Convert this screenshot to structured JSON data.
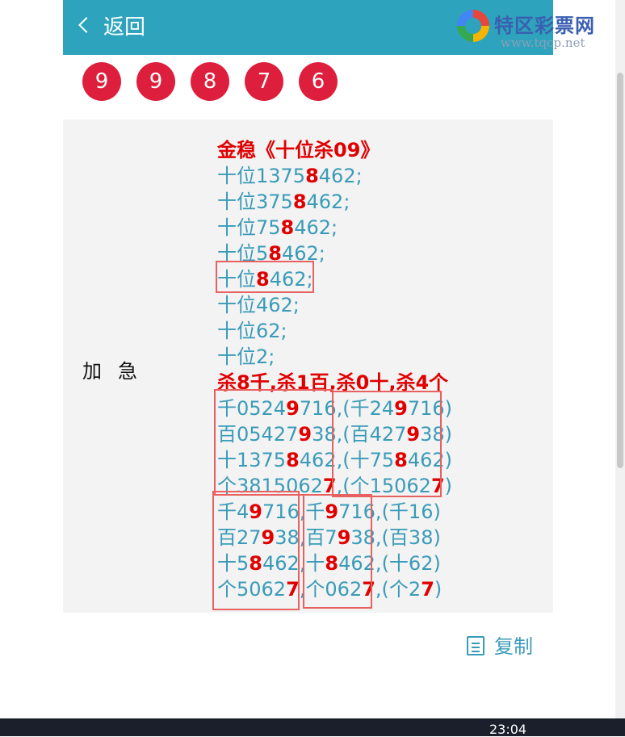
{
  "header": {
    "back_label": "返回",
    "logo_text": "特区彩票网",
    "logo_url": "www.tqcp.net"
  },
  "balls": [
    "9",
    "9",
    "8",
    "7",
    "6"
  ],
  "panel": {
    "label": "加急",
    "lines": [
      {
        "style": "red",
        "segments": [
          {
            "t": "金稳《十位杀09》",
            "r": false
          }
        ]
      },
      {
        "style": "normal",
        "segments": [
          {
            "t": "十位1375",
            "r": false
          },
          {
            "t": "8",
            "r": true
          },
          {
            "t": "462;",
            "r": false
          }
        ]
      },
      {
        "style": "normal",
        "segments": [
          {
            "t": "十位375",
            "r": false
          },
          {
            "t": "8",
            "r": true
          },
          {
            "t": "462;",
            "r": false
          }
        ]
      },
      {
        "style": "normal",
        "segments": [
          {
            "t": "十位75",
            "r": false
          },
          {
            "t": "8",
            "r": true
          },
          {
            "t": "462;",
            "r": false
          }
        ]
      },
      {
        "style": "normal",
        "segments": [
          {
            "t": "十位5",
            "r": false
          },
          {
            "t": "8",
            "r": true
          },
          {
            "t": "462;",
            "r": false
          }
        ]
      },
      {
        "style": "normal",
        "segments": [
          {
            "t": "十位",
            "r": false
          },
          {
            "t": "8",
            "r": true
          },
          {
            "t": "462;",
            "r": false
          }
        ]
      },
      {
        "style": "normal",
        "segments": [
          {
            "t": "十位462;",
            "r": false
          }
        ]
      },
      {
        "style": "normal",
        "segments": [
          {
            "t": "十位62;",
            "r": false
          }
        ]
      },
      {
        "style": "normal",
        "segments": [
          {
            "t": "十位2;",
            "r": false
          }
        ]
      },
      {
        "style": "red",
        "segments": [
          {
            "t": "杀8千",
            "r": false
          },
          {
            "t": ",",
            "r": false
          },
          {
            "t": "杀1百",
            "r": false
          },
          {
            "t": ",",
            "r": false
          },
          {
            "t": "杀0十",
            "r": false
          },
          {
            "t": ",",
            "r": false
          },
          {
            "t": "杀4个",
            "r": false
          }
        ]
      },
      {
        "style": "normal",
        "segments": [
          {
            "t": "千0524",
            "r": false
          },
          {
            "t": "9",
            "r": true
          },
          {
            "t": "716,(千24",
            "r": false
          },
          {
            "t": "9",
            "r": true
          },
          {
            "t": "716)",
            "r": false
          }
        ]
      },
      {
        "style": "normal",
        "segments": [
          {
            "t": "百05427",
            "r": false
          },
          {
            "t": "9",
            "r": true
          },
          {
            "t": "38,(百427",
            "r": false
          },
          {
            "t": "9",
            "r": true
          },
          {
            "t": "38)",
            "r": false
          }
        ]
      },
      {
        "style": "normal",
        "segments": [
          {
            "t": "十1375",
            "r": false
          },
          {
            "t": "8",
            "r": true
          },
          {
            "t": "462,(十75",
            "r": false
          },
          {
            "t": "8",
            "r": true
          },
          {
            "t": "462)",
            "r": false
          }
        ]
      },
      {
        "style": "normal",
        "segments": [
          {
            "t": "个3815062",
            "r": false
          },
          {
            "t": "7",
            "r": true
          },
          {
            "t": ",(个15062",
            "r": false
          },
          {
            "t": "7",
            "r": true
          },
          {
            "t": ")",
            "r": false
          }
        ]
      },
      {
        "style": "normal",
        "segments": [
          {
            "t": "千4",
            "r": false
          },
          {
            "t": "9",
            "r": true
          },
          {
            "t": "716,千",
            "r": false
          },
          {
            "t": "9",
            "r": true
          },
          {
            "t": "716,(千16)",
            "r": false
          }
        ]
      },
      {
        "style": "normal",
        "segments": [
          {
            "t": "百27",
            "r": false
          },
          {
            "t": "9",
            "r": true
          },
          {
            "t": "38,百7",
            "r": false
          },
          {
            "t": "9",
            "r": true
          },
          {
            "t": "38,(百38)",
            "r": false
          }
        ]
      },
      {
        "style": "normal",
        "segments": [
          {
            "t": "十5",
            "r": false
          },
          {
            "t": "8",
            "r": true
          },
          {
            "t": "462,十",
            "r": false
          },
          {
            "t": "8",
            "r": true
          },
          {
            "t": "462,(十62)",
            "r": false
          }
        ]
      },
      {
        "style": "normal",
        "segments": [
          {
            "t": "个5062",
            "r": false
          },
          {
            "t": "7",
            "r": true
          },
          {
            "t": ",个062",
            "r": false
          },
          {
            "t": "7",
            "r": true
          },
          {
            "t": ",(个2",
            "r": false
          },
          {
            "t": "7",
            "r": true
          },
          {
            "t": ")",
            "r": false
          }
        ]
      }
    ]
  },
  "copy_label": "复制",
  "taskbar_time": "23:04"
}
